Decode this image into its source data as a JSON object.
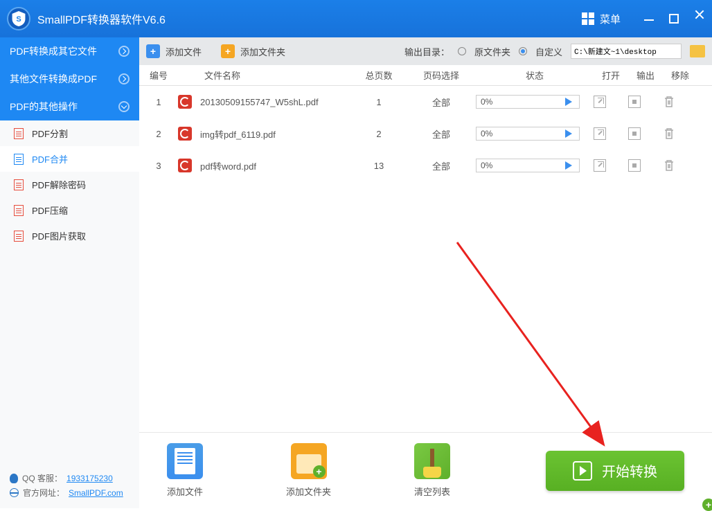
{
  "titlebar": {
    "app_title": "SmallPDF转换器软件V6.6",
    "menu": "菜单"
  },
  "sidebar": {
    "cats": [
      {
        "label": "PDF转换成其它文件"
      },
      {
        "label": "其他文件转换成PDF"
      },
      {
        "label": "PDF的其他操作"
      }
    ],
    "opts": [
      {
        "label": "PDF分割"
      },
      {
        "label": "PDF合并"
      },
      {
        "label": "PDF解除密码"
      },
      {
        "label": "PDF压缩"
      },
      {
        "label": "PDF图片获取"
      }
    ],
    "qq_label": "QQ 客服：",
    "qq_num": "1933175230",
    "site_label": "官方网址：",
    "site_url": "SmallPDF.com"
  },
  "toolbar": {
    "add_file": "添加文件",
    "add_folder": "添加文件夹",
    "out_dir": "输出目录：",
    "opt_source": "原文件夹",
    "opt_custom": "自定义",
    "path": "C:\\新建文~1\\desktop"
  },
  "table": {
    "hdr": {
      "idx": "编号",
      "name": "文件名称",
      "pages": "总页数",
      "sel": "页码选择",
      "status": "状态",
      "open": "打开",
      "out": "输出",
      "del": "移除"
    },
    "rows": [
      {
        "idx": "1",
        "name": "20130509155747_W5shL.pdf",
        "pages": "1",
        "sel": "全部",
        "pct": "0%"
      },
      {
        "idx": "2",
        "name": "img转pdf_6119.pdf",
        "pages": "2",
        "sel": "全部",
        "pct": "0%"
      },
      {
        "idx": "3",
        "name": "pdf转word.pdf",
        "pages": "13",
        "sel": "全部",
        "pct": "0%"
      }
    ]
  },
  "bottom": {
    "add_file": "添加文件",
    "add_folder": "添加文件夹",
    "clear": "清空列表",
    "start": "开始转换"
  }
}
